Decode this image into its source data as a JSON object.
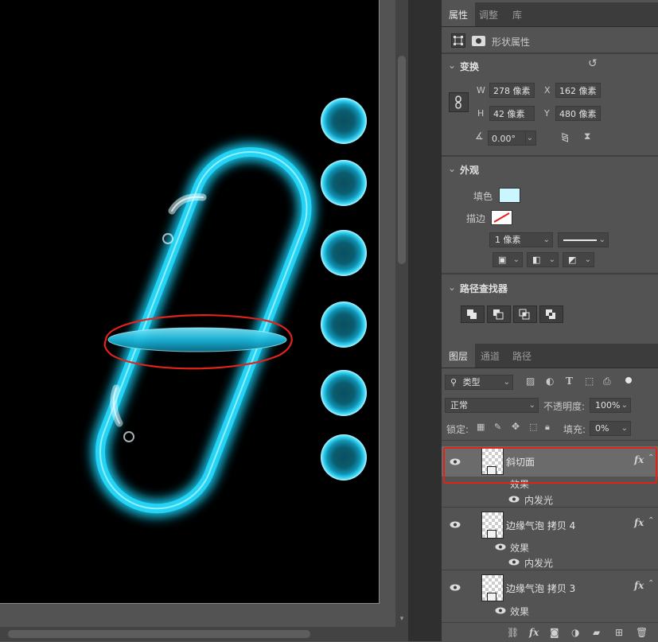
{
  "properties_panel": {
    "tabs": [
      "属性",
      "调整",
      "库"
    ],
    "shape_header": "形状属性",
    "transform": {
      "title": "变换",
      "w_label": "W",
      "w_value": "278 像素",
      "h_label": "H",
      "h_value": "42 像素",
      "x_label": "X",
      "x_value": "162 像素",
      "y_label": "Y",
      "y_value": "480 像素",
      "angle_value": "0.00°"
    },
    "appearance": {
      "title": "外观",
      "fill_label": "填色",
      "fill_color": "#c9f6ff",
      "stroke_label": "描边",
      "stroke_width": "1 像素"
    },
    "pathfinder": {
      "title": "路径查找器"
    }
  },
  "layers_panel": {
    "tabs": [
      "图层",
      "通道",
      "路径"
    ],
    "filter_label": "类型",
    "blend_mode": "正常",
    "opacity_label": "不透明度:",
    "opacity_value": "100%",
    "lock_label": "锁定:",
    "fill_label": "填充:",
    "fill_value": "0%",
    "layers": [
      {
        "name": "斜切面",
        "selected": true,
        "effects_label": "效果",
        "effects": [
          "内发光"
        ]
      },
      {
        "name": "边缘气泡 拷贝 4",
        "selected": false,
        "effects_label": "效果",
        "effects": [
          "内发光"
        ]
      },
      {
        "name": "边缘气泡 拷贝 3",
        "selected": false,
        "effects_label": "效果",
        "effects": []
      }
    ],
    "fx_label": "fx"
  },
  "colors": {
    "glow": "#17c8ec",
    "highlight": "#e0231b",
    "panel": "#535353"
  }
}
